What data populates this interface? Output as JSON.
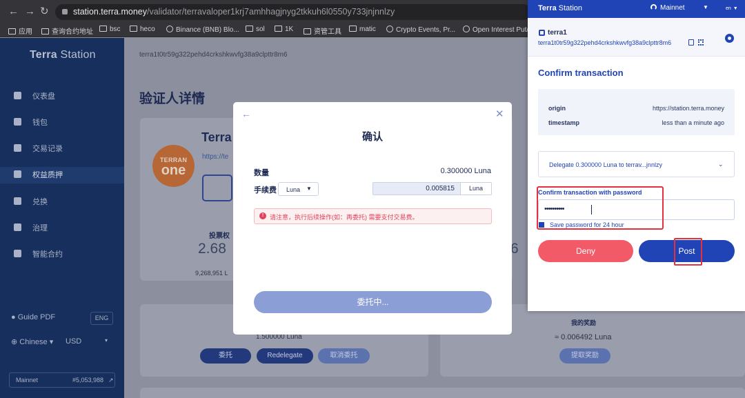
{
  "browser": {
    "url_domain": "station.terra.money",
    "url_path": "/validator/terravaloper1krj7amhhagjnyg2tkkuh6l0550y733jnjnnlzy",
    "bookmarks": [
      "应用",
      "查询合约地址",
      "bsc",
      "heco",
      "Binance (BNB) Blo...",
      "sol",
      "1K",
      "资管工具",
      "matic",
      "Crypto Events, Pr...",
      "Open Interest Put/..."
    ]
  },
  "sidebar": {
    "logo_bold": "Terra",
    "logo_light": " Station",
    "items": [
      {
        "label": "仪表盘",
        "icon": "dashboard-icon"
      },
      {
        "label": "钱包",
        "icon": "wallet-icon"
      },
      {
        "label": "交易记录",
        "icon": "history-icon"
      },
      {
        "label": "权益质押",
        "icon": "staking-icon"
      },
      {
        "label": "兑换",
        "icon": "swap-icon"
      },
      {
        "label": "治理",
        "icon": "governance-icon"
      },
      {
        "label": "智能合约",
        "icon": "contracts-icon"
      }
    ],
    "guide": "Guide PDF",
    "eng": "ENG",
    "language": "Chinese",
    "currency": "USD",
    "network": "Mainnet",
    "block": "#5,053,988"
  },
  "page": {
    "address": "terra1t0tr59g322pehd4crkshkwvfg38a9clpttr8m6",
    "title": "验证人详情",
    "validator_name": "Terra",
    "validator_link": "https://te",
    "logo_line1": "TERRAN",
    "logo_line2": "one",
    "voting_power_label": "投票权",
    "voting_power_value": "2.68",
    "voting_power_sub": "9,268,951 L",
    "right_value": "6",
    "delegation_amount": "1.500000 Luna",
    "my_rewards_label": "我的奖励",
    "my_rewards_value": "≈ 0.006492 Luna",
    "delegate_btn": "委托",
    "redelegate_btn": "Redelegate",
    "undelegate_btn": "取消委托",
    "withdraw_btn": "提取奖励"
  },
  "modal": {
    "title": "确认",
    "amount_label": "数量",
    "amount_value": "0.300000 Luna",
    "fee_label": "手续费",
    "fee_denom": "Luna",
    "fee_value": "0.005815",
    "fee_unit": "Luna",
    "warning": "请注意，执行后续操作(如：再委托) 需要支付交易费。",
    "submit": "委托中..."
  },
  "extension": {
    "brand_bold": "Terra",
    "brand_light": " Station",
    "network": "Mainnet",
    "lang": "en",
    "wallet_name": "terra1",
    "wallet_address": "terra1t0tr59g322pehd4crkshkwvfg38a9clpttr8m6",
    "confirm_title": "Confirm transaction",
    "origin_key": "origin",
    "origin_value": "https://station.terra.money",
    "timestamp_key": "timestamp",
    "timestamp_value": "less than a minute ago",
    "message": "Delegate 0.300000 Luna to terrav...jnnlzy",
    "password_label": "Confirm transaction with password",
    "password_masked": "••••••••••",
    "save_password": "Save password for 24 hour",
    "deny": "Deny",
    "post": "Post"
  },
  "colors": {
    "accent": "#2043b5",
    "danger": "#f25a67",
    "highlight": "#e5303d"
  }
}
